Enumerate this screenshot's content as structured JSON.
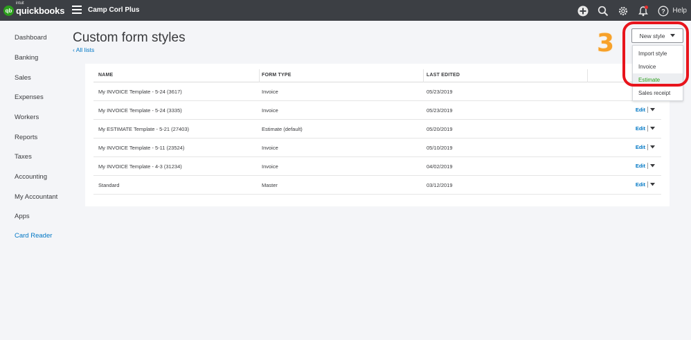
{
  "topbar": {
    "logo_intuit": "intuit",
    "logo_text": "quickbooks",
    "logo_badge": "qb",
    "company_name": "Camp Corl Plus",
    "help_label": "Help",
    "icons": [
      "plus-circle-icon",
      "search-icon",
      "gear-icon",
      "bell-icon",
      "help-icon"
    ]
  },
  "sidebar": {
    "items": [
      {
        "label": "Dashboard"
      },
      {
        "label": "Banking"
      },
      {
        "label": "Sales"
      },
      {
        "label": "Expenses"
      },
      {
        "label": "Workers"
      },
      {
        "label": "Reports"
      },
      {
        "label": "Taxes"
      },
      {
        "label": "Accounting"
      },
      {
        "label": "My Accountant"
      },
      {
        "label": "Apps"
      },
      {
        "label": "Card Reader"
      }
    ]
  },
  "page": {
    "title": "Custom form styles",
    "back_link": "All lists"
  },
  "new_style": {
    "label": "New style",
    "menu": [
      "Import style",
      "Invoice",
      "Estimate",
      "Sales receipt"
    ],
    "highlighted": "Estimate"
  },
  "table": {
    "columns": [
      "NAME",
      "FORM TYPE",
      "LAST EDITED"
    ],
    "action_label": "Edit",
    "rows": [
      {
        "name": "My INVOICE Template - 5-24 (3617)",
        "type": "Invoice",
        "edited": "05/23/2019"
      },
      {
        "name": "My INVOICE Template - 5-24 (3335)",
        "type": "Invoice",
        "edited": "05/23/2019"
      },
      {
        "name": "My ESTIMATE Template - 5-21 (27403)",
        "type": "Estimate (default)",
        "edited": "05/20/2019"
      },
      {
        "name": "My INVOICE Template - 5-11 (23524)",
        "type": "Invoice",
        "edited": "05/10/2019"
      },
      {
        "name": "My INVOICE Template - 4-3 (31234)",
        "type": "Invoice",
        "edited": "04/02/2019"
      },
      {
        "name": "Standard",
        "type": "Master",
        "edited": "03/12/2019"
      }
    ]
  },
  "annotation": {
    "step_number": "3",
    "color": "#e8141c"
  },
  "colors": {
    "topbar": "#3c3f44",
    "link": "#0077c5",
    "brand_green": "#2ca01c",
    "background": "#f4f5f8"
  }
}
